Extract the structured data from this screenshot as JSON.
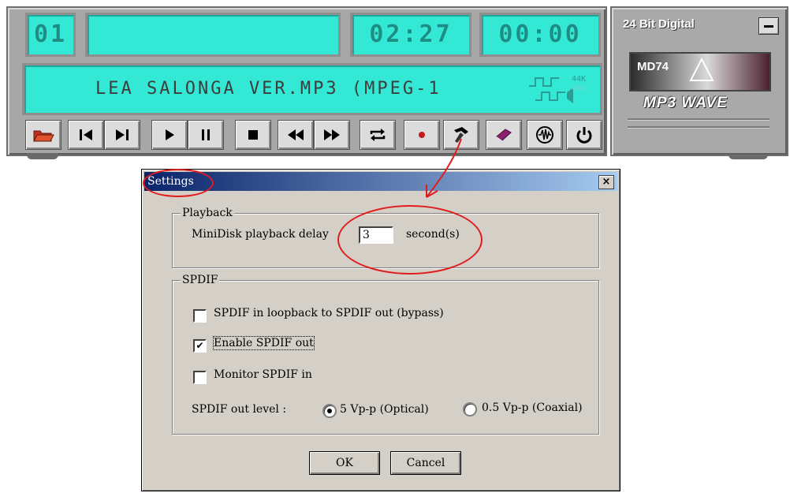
{
  "player": {
    "track_number": "01",
    "title_display": "",
    "elapsed_time": "02:27",
    "remaining_time": "00:00",
    "song_text": "LEA SALONGA VER.MP3 (MPEG-1",
    "sample_rate_icons": [
      "44K",
      "48K"
    ],
    "buttons": [
      {
        "name": "open-folder",
        "icon": "folder-icon"
      },
      {
        "name": "previous-track",
        "icon": "skip-back-icon"
      },
      {
        "name": "next-track",
        "icon": "skip-forward-icon"
      },
      {
        "name": "play",
        "icon": "play-icon"
      },
      {
        "name": "pause",
        "icon": "pause-icon"
      },
      {
        "name": "stop",
        "icon": "stop-icon"
      },
      {
        "name": "rewind",
        "icon": "rewind-icon"
      },
      {
        "name": "fast-forward",
        "icon": "fast-forward-icon"
      },
      {
        "name": "repeat",
        "icon": "repeat-icon"
      },
      {
        "name": "record",
        "icon": "record-icon"
      },
      {
        "name": "settings",
        "icon": "hammer-icon"
      },
      {
        "name": "notes",
        "icon": "book-icon"
      },
      {
        "name": "waveform",
        "icon": "wave-icon"
      },
      {
        "name": "power",
        "icon": "power-icon"
      }
    ],
    "brand_top": "24 Bit Digital",
    "logo_text": "MD74",
    "brand_name": "MP3 WAVE",
    "lcd_color": "#34e8d6"
  },
  "dialog": {
    "title": "Settings",
    "close_label": "×",
    "playback": {
      "group_label": "Playback",
      "delay_label": "MiniDisk playback delay",
      "delay_value": "3",
      "unit_label": "second(s)"
    },
    "spdif": {
      "group_label": "SPDIF",
      "options": [
        {
          "label": "SPDIF in loopback to SPDIF out (bypass)",
          "checked": false
        },
        {
          "label": "Enable SPDIF out",
          "checked": true
        },
        {
          "label": "Monitor SPDIF in",
          "checked": false
        }
      ],
      "level_label": "SPDIF out level :",
      "level_options": [
        {
          "label": "5 Vp-p (Optical)",
          "selected": true
        },
        {
          "label": "0.5 Vp-p (Coaxial)",
          "selected": false
        }
      ]
    },
    "ok_label": "OK",
    "cancel_label": "Cancel",
    "titlebar_gradient": [
      "#0a246a",
      "#a6caf0"
    ]
  },
  "annotation_color": "#e21c1c"
}
